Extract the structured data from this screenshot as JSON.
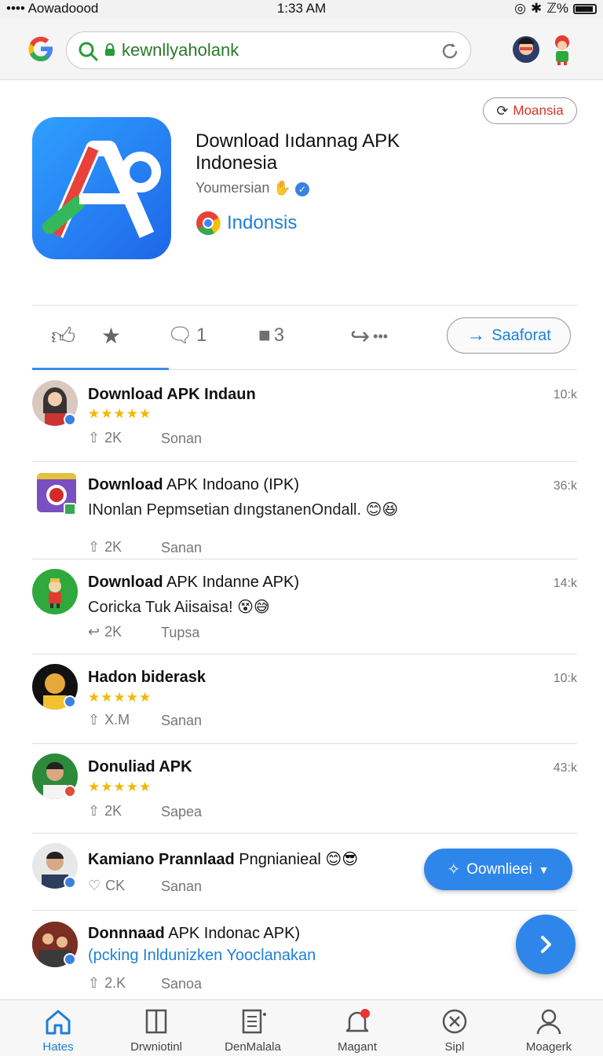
{
  "status_bar": {
    "carrier": "•••• Aowadoood",
    "time": "1:33 AM",
    "battery": "ℤ%"
  },
  "browser": {
    "url": "kewnllyaholank"
  },
  "app": {
    "title": "Download Iıdannag APK Indonesia",
    "author": "Youmersian",
    "region": "Indonsis",
    "chip_label": "Moansia"
  },
  "actions": {
    "comment_count": "1",
    "message_count": "3",
    "share_label": "•••",
    "primary_button": "Saaforat"
  },
  "feed": [
    {
      "title_bold": "Download APK Indaun",
      "title_rest": "",
      "stars": "★★★★★",
      "sub": "",
      "count": "2K",
      "meta": "Sonan",
      "time": "10:k"
    },
    {
      "title_bold": "Download",
      "title_rest": " APK Indoano (IPK)",
      "stars": "",
      "sub": "INonlan Pepmsetian dıngstanenOndall.",
      "count": "2K",
      "meta": "Sanan",
      "time": "36:k"
    },
    {
      "title_bold": "Download",
      "title_rest": " APK Indanne APK)",
      "stars": "",
      "sub": "Coricka  Tuk Aiisaisa!",
      "count": "2K",
      "meta": "Tupsa",
      "time": "14:k"
    },
    {
      "title_bold": "Hadon biderask",
      "title_rest": "",
      "stars": "★★★★★",
      "sub": "",
      "count": "X.M",
      "meta": "Sanan",
      "time": "10:k"
    },
    {
      "title_bold": "Donuliad APK",
      "title_rest": "",
      "stars": "★★★★★",
      "sub": "",
      "count": "2K",
      "meta": "Sapea",
      "time": "43:k"
    },
    {
      "title_bold": "Kamiano Prannlaad",
      "title_rest": " Pngnianieal",
      "stars": "",
      "sub": "",
      "count": "CK",
      "meta": "Sanan",
      "time": ""
    },
    {
      "title_bold": "Donnnaad",
      "title_rest": " APK Indonac APK)",
      "stars": "",
      "sub": "(pcking Inldunizken Yooclanakan",
      "count": "2.K",
      "meta": "Sanoa",
      "time": ""
    }
  ],
  "download_button": "Oownlieei",
  "bottom_nav": [
    {
      "label": "Hates"
    },
    {
      "label": "Drwniotinl"
    },
    {
      "label": "DenMalala"
    },
    {
      "label": "Magant"
    },
    {
      "label": "Sipl"
    },
    {
      "label": "Moagerk"
    }
  ]
}
